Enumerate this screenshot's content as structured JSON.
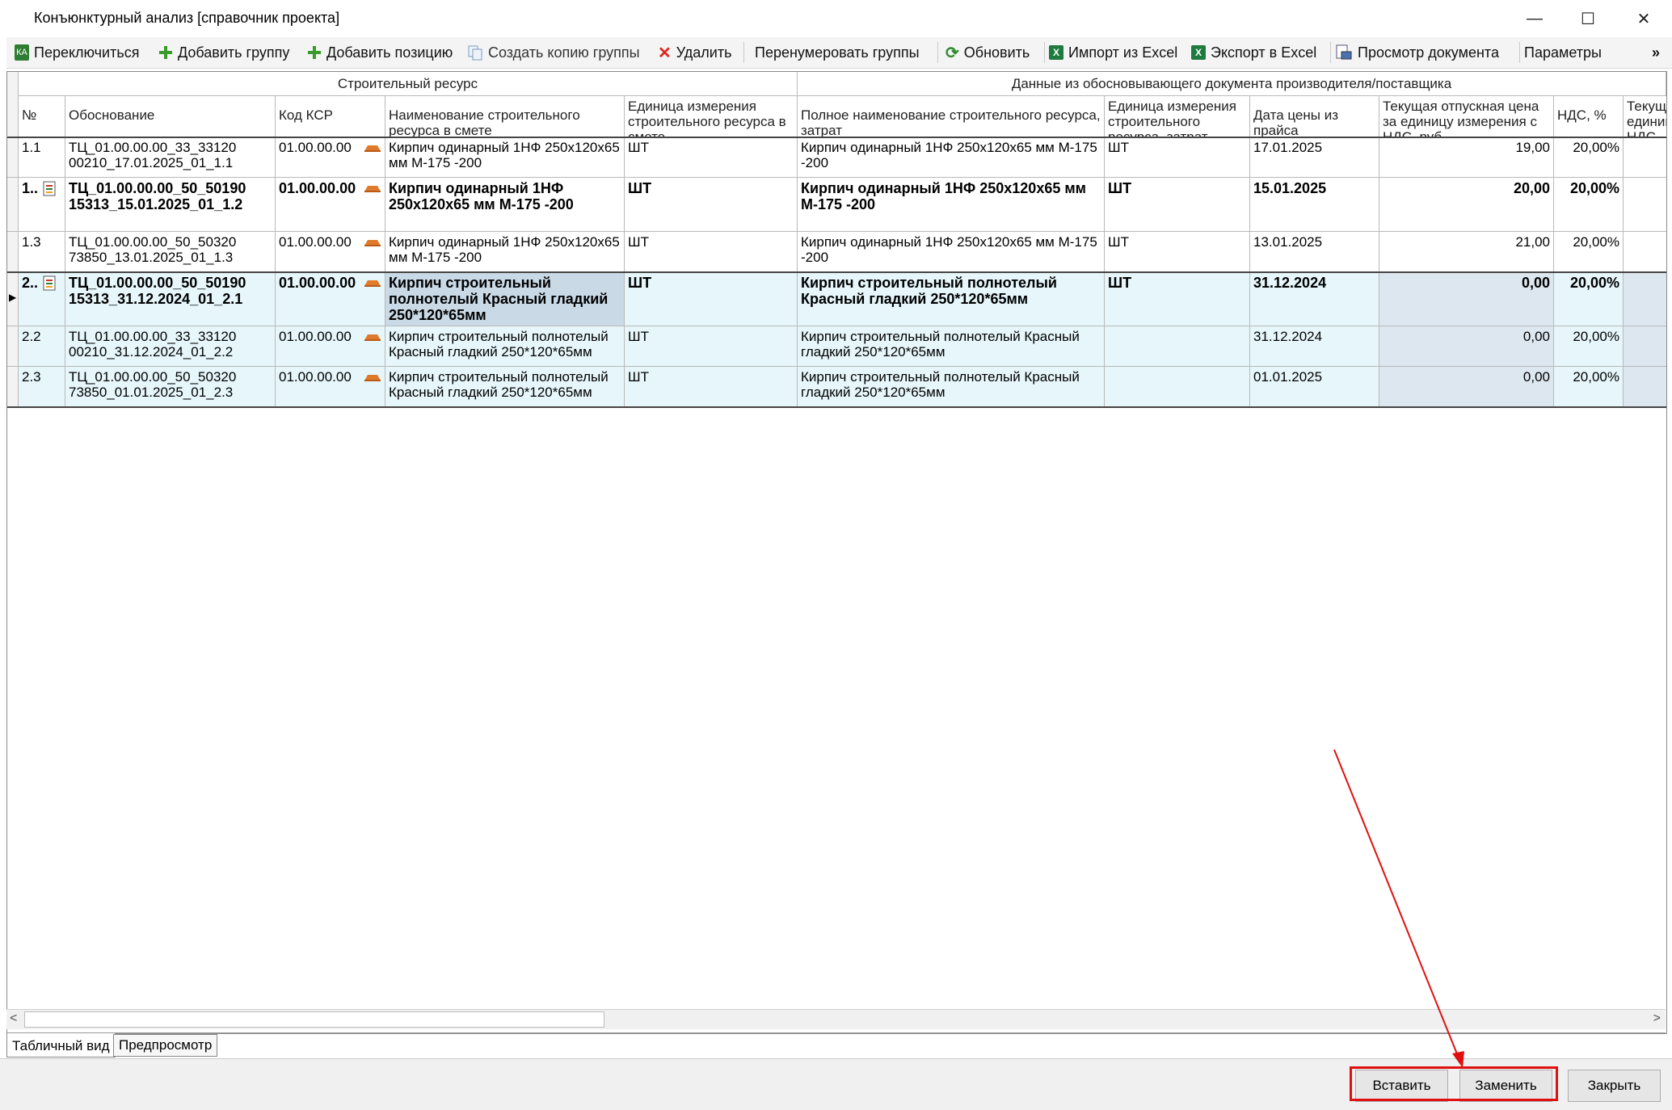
{
  "window": {
    "title": "Конъюнктурный анализ [справочник проекта]",
    "minimize": "—",
    "maximize": "☐",
    "close": "✕"
  },
  "toolbar": {
    "switch": "Переключиться",
    "add_group": "Добавить группу",
    "add_position": "Добавить позицию",
    "copy_group": "Создать копию группы",
    "delete": "Удалить",
    "renumber": "Перенумеровать группы",
    "refresh": "Обновить",
    "import_excel": "Импорт из Excel",
    "export_excel": "Экспорт в Excel",
    "view_doc": "Просмотр документа",
    "params": "Параметры",
    "overflow": "»"
  },
  "grid": {
    "group_headers": [
      "Строительный ресурс",
      "Данные из обосновывающего документа производителя/поставщика"
    ],
    "columns": [
      "№",
      "Обоснование",
      "Код КСР",
      "Наименование строительного ресурса в смете",
      "Единица измерения строительного ресурса в смете",
      "Полное наименование строительного ресурса, затрат",
      "Единица измерения строительного ресурса, затрат",
      "Дата цены из прайса",
      "Текущая отпускная цена за единицу измерения с НДС, руб.",
      "НДС, %",
      "Текущая единиц НДС, р"
    ],
    "rows": [
      {
        "num": "1.1",
        "basis": "ТЦ_01.00.00.00_33_33120 00210_17.01.2025_01_1.1",
        "code": "01.00.00.00",
        "name": "Кирпич одинарный 1НФ 250х120х65 мм М-175 -200",
        "unit": "ШТ",
        "full": "Кирпич одинарный 1НФ 250х120х65 мм М-175 -200",
        "unit2": "ШТ",
        "date": "17.01.2025",
        "price": "19,00",
        "vat": "20,00%"
      },
      {
        "num": "1..",
        "basis": "ТЦ_01.00.00.00_50_50190 15313_15.01.2025_01_1.2",
        "code": "01.00.00.00",
        "name": "Кирпич одинарный 1НФ 250х120х65 мм М-175 -200",
        "unit": "ШТ",
        "full": "Кирпич одинарный 1НФ 250х120х65 мм М-175 -200",
        "unit2": "ШТ",
        "date": "15.01.2025",
        "price": "20,00",
        "vat": "20,00%"
      },
      {
        "num": "1.3",
        "basis": "ТЦ_01.00.00.00_50_50320 73850_13.01.2025_01_1.3",
        "code": "01.00.00.00",
        "name": "Кирпич одинарный 1НФ 250х120х65 мм М-175 -200",
        "unit": "ШТ",
        "full": "Кирпич одинарный 1НФ 250х120х65 мм М-175 -200",
        "unit2": "ШТ",
        "date": "13.01.2025",
        "price": "21,00",
        "vat": "20,00%"
      },
      {
        "num": "2..",
        "basis": "ТЦ_01.00.00.00_50_50190 15313_31.12.2024_01_2.1",
        "code": "01.00.00.00",
        "name": "Кирпич строительный полнотелый Красный гладкий 250*120*65мм",
        "unit": "ШТ",
        "full": "Кирпич строительный полнотелый Красный гладкий 250*120*65мм",
        "unit2": "ШТ",
        "date": "31.12.2024",
        "price": "0,00",
        "vat": "20,00%"
      },
      {
        "num": "2.2",
        "basis": "ТЦ_01.00.00.00_33_33120 00210_31.12.2024_01_2.2",
        "code": "01.00.00.00",
        "name": "Кирпич строительный полнотелый Красный гладкий 250*120*65мм",
        "unit": "ШТ",
        "full": "Кирпич строительный полнотелый Красный гладкий 250*120*65мм",
        "unit2": "",
        "date": "31.12.2024",
        "price": "0,00",
        "vat": "20,00%"
      },
      {
        "num": "2.3",
        "basis": "ТЦ_01.00.00.00_50_50320 73850_01.01.2025_01_2.3",
        "code": "01.00.00.00",
        "name": "Кирпич строительный полнотелый Красный гладкий 250*120*65мм",
        "unit": "ШТ",
        "full": "Кирпич строительный полнотелый Красный гладкий 250*120*65мм",
        "unit2": "",
        "date": "01.01.2025",
        "price": "0,00",
        "vat": "20,00%"
      }
    ]
  },
  "tabs": {
    "table": "Табличный вид",
    "preview": "Предпросмотр"
  },
  "buttons": {
    "insert": "Вставить",
    "replace": "Заменить",
    "close": "Закрыть"
  },
  "colors": {
    "selected_group": "#e6f6fb",
    "selected_cell": "#c9d9e6",
    "price_cell": "#dde7ef",
    "highlight": "#e01010",
    "brick": "#e07a2a"
  }
}
